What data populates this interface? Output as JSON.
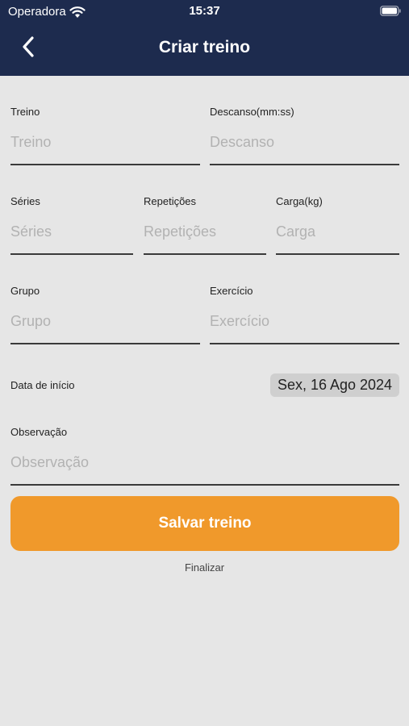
{
  "status_bar": {
    "carrier": "Operadora",
    "time": "15:37",
    "wifi_icon": "wifi-icon",
    "battery_icon": "battery-icon"
  },
  "header": {
    "title": "Criar treino",
    "back_icon": "chevron-left-icon",
    "background": "#1d2b4e"
  },
  "form": {
    "treino": {
      "label": "Treino",
      "placeholder": "Treino",
      "value": ""
    },
    "descanso": {
      "label": "Descanso(mm:ss)",
      "placeholder": "Descanso",
      "value": ""
    },
    "series": {
      "label": "Séries",
      "placeholder": "Séries",
      "value": ""
    },
    "repeticoes": {
      "label": "Repetições",
      "placeholder": "Repetições",
      "value": ""
    },
    "carga": {
      "label": "Carga(kg)",
      "placeholder": "Carga",
      "value": ""
    },
    "grupo": {
      "label": "Grupo",
      "placeholder": "Grupo",
      "value": ""
    },
    "exercicio": {
      "label": "Exercício",
      "placeholder": "Exercício",
      "value": ""
    },
    "data_inicio": {
      "label": "Data de início",
      "value": "Sex, 16 Ago 2024"
    },
    "observacao": {
      "label": "Observação",
      "placeholder": "Observação",
      "value": ""
    }
  },
  "actions": {
    "save_label": "Salvar treino",
    "finalize_label": "Finalizar",
    "accent_color": "#f0992b"
  }
}
